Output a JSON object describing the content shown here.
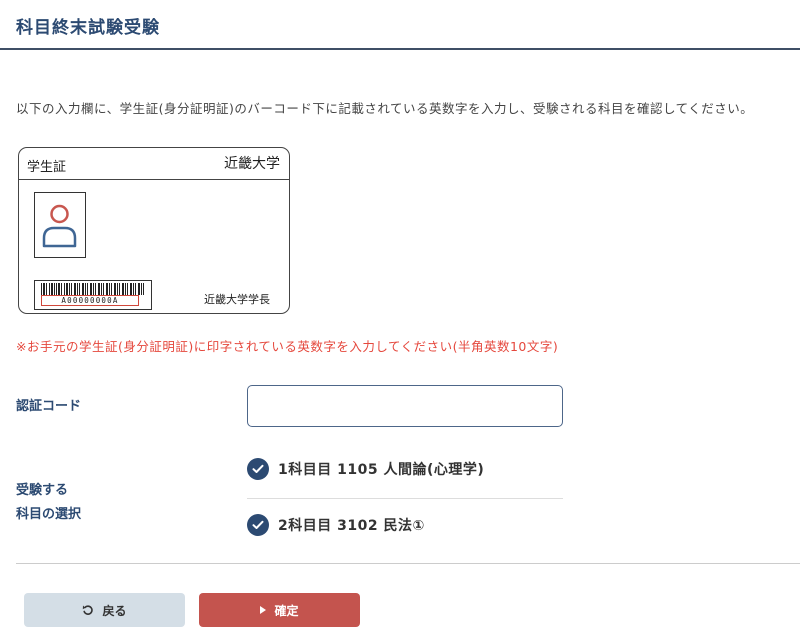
{
  "header": {
    "title": "科目終末試験受験"
  },
  "instruction": "以下の入力欄に、学生証(身分証明証)のバーコード下に記載されている英数字を入力し、受験される科目を確認してください。",
  "card": {
    "label": "学生証",
    "university": "近畿大学",
    "barcode_number": "A00000000A",
    "president": "近畿大学学長"
  },
  "notice": "※お手元の学生証(身分証明証)に印字されている英数字を入力してください(半角英数10文字)",
  "form": {
    "code_label": "認証コード",
    "code_value": "",
    "subject_label_line1": "受験する",
    "subject_label_line2": "科目の選択",
    "subjects": [
      {
        "text": "1科目目 1105 人間論(心理学)",
        "checked": true
      },
      {
        "text": "2科目目 3102 民法①",
        "checked": true
      }
    ]
  },
  "buttons": {
    "back": "戻る",
    "confirm": "確定"
  },
  "colors": {
    "accent": "#2c4a72",
    "danger": "#e5483d",
    "confirm_button": "#c4544e",
    "back_button": "#d4dee6"
  }
}
